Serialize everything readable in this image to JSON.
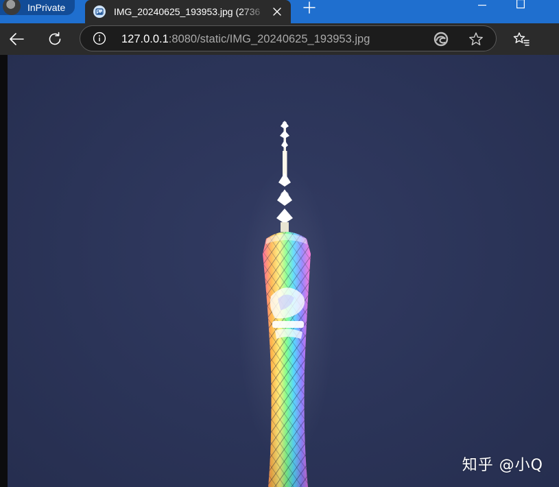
{
  "browser": {
    "inprivate_label": "InPrivate",
    "tab": {
      "title": "IMG_20240625_193953.jpg (2736"
    },
    "address": {
      "host": "127.0.0.1",
      "rest": ":8080/static/IMG_20240625_193953.jpg"
    }
  },
  "content": {
    "watermark": "知乎 @小Q"
  },
  "colors": {
    "tabstrip": "#1f6fcf",
    "tab_active": "#2b2b2b",
    "toolbar": "#2b2b2b",
    "night_sky": "#2b3458"
  },
  "icons": {
    "back": "arrow-left",
    "refresh": "circular-arrow",
    "info": "circle-i",
    "browser_essentials": "edge-logo",
    "favorite": "star",
    "favorites": "star-with-list",
    "new_tab": "plus",
    "close_tab": "x",
    "minimize": "dash",
    "maximize": "square"
  }
}
